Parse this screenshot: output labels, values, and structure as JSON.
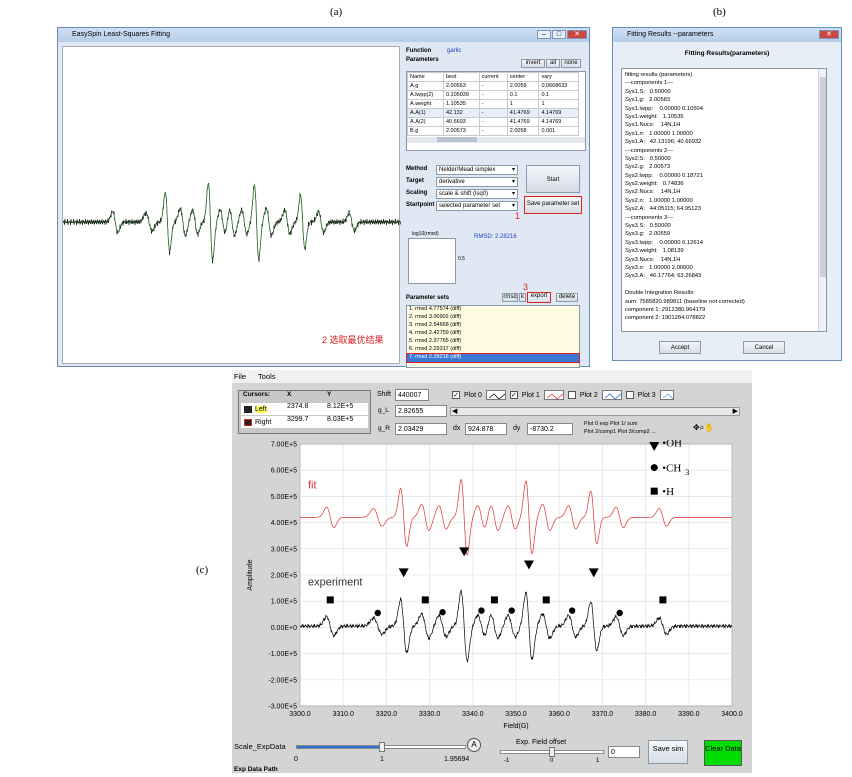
{
  "labels": {
    "a": "(a)",
    "b": "(b)",
    "c": "(c)"
  },
  "easyspin": {
    "title": "EasySpin Least-Squares Fitting",
    "function_label": "Function",
    "function_value": "garlic",
    "parameters_label": "Parameters",
    "buttons": {
      "invert": "invert",
      "all": "all",
      "none": "none",
      "start": "Start",
      "save_param": "Save parameter set",
      "rmsd": "rmsd",
      "k": "k",
      "export": "export",
      "delete": "delete"
    },
    "table_headers": [
      "Name",
      "best",
      "current",
      "center",
      "vary"
    ],
    "table_rows": [
      [
        "A.g",
        "2.00563",
        "-",
        "2.0059",
        "0.0668633"
      ],
      [
        "A.lwpp(2)",
        "0.105039",
        "-",
        "0.1",
        "0.1"
      ],
      [
        "A.weight",
        "1.10535",
        "-",
        "1",
        "1"
      ],
      [
        "A.A(1)",
        "42.132",
        "-",
        "41.4769",
        "4.14769"
      ],
      [
        "A.A(2)",
        "40.6693",
        "-",
        "41.4769",
        "4.14769"
      ],
      [
        "B.g",
        "2.00573",
        "-",
        "2.0058",
        "0.001"
      ]
    ],
    "method_label": "Method",
    "method_value": "Nelder/Mead simplex",
    "target_label": "Target",
    "target_value": "derivative",
    "scaling_label": "Scaling",
    "scaling_value": "scale & shift (lsq0)",
    "startpoint_label": "Startpoint",
    "startpoint_value": "selected parameter set",
    "log_label": "log10(rmsd)",
    "log_tick": "0.5",
    "rmsd_text": "RMSD: 2.28216",
    "param_sets_label": "Parameter sets",
    "param_sets": [
      "1. rmsd 4.77574 (diff)",
      "2. rmsd 3.00902 (diff)",
      "3. rmsd 2.54668 (diff)",
      "4. rmsd 2.42759 (diff)",
      "5. rmsd 2.37765 (diff)",
      "6. rmsd 2.29317 (diff)",
      "7. rmsd 2.28216 (diff)"
    ],
    "annot1": "1",
    "annot2": "2 选取最优结果",
    "annot3": "3"
  },
  "fitres": {
    "title": "Fitting Results --parameters",
    "heading": "Fitting Results(parameters)",
    "lines": [
      "fitting results (parameters)",
      "---components 1---",
      "Sys1.S:   0.50000",
      "Sys1.g:   2.00583",
      "Sys1.lwpp:    0.00000 0.10504",
      "Sys1.weight:   1.10535",
      "Sys1.Nucs:    14N,1H",
      "Sys1.n:   1.00000 1.00000",
      "Sys1.A:   42.13196; 40.66932",
      "---components 2---",
      "Sys2.S:   0.50000",
      "Sys2.g:   2.00573",
      "Sys2.lwpp:    0.00000 0.18721",
      "Sys2.weight:   0.74836",
      "Sys2.Nucs:    14N,1H",
      "Sys2.n:   1.00000 1.00000",
      "Sys2.A:   44.05115; 64.95123",
      "---components 3---",
      "Sys3.S:   0.50000",
      "Sys3.g:   2.00559",
      "Sys3.lwpp:    0.00000 0.12614",
      "Sys3.weight:   1.08139",
      "Sys3.Nucs:    14N,1H",
      "Sys3.n:   1.00000 2.00000",
      "Sys3.A:   46.17764; 63.26843",
      "",
      "Double Integration Results:",
      "sum: 7585820.989811 (baseline not corrected)",
      "component 1: 2912380.964179",
      "component 2: 1901284.078822"
    ],
    "accept": "Accept",
    "cancel": "Cancel"
  },
  "labview": {
    "menu": [
      "File",
      "Tools"
    ],
    "cursors_label": "Cursors:",
    "cursor_x": "X",
    "cursor_y": "Y",
    "cursor_rows": [
      [
        "Left",
        "2374.8",
        "8.12E+5"
      ],
      [
        "Right",
        "3299.7",
        "8.03E+5"
      ]
    ],
    "shift_label": "Shift",
    "shift_value": "440007",
    "gl_label": "g_L",
    "gl_value": "2.82655",
    "gr_label": "g_R",
    "gr_value": "2.03429",
    "dx_label": "dx",
    "dx_value": "924.878",
    "dy_label": "dy",
    "dy_value": "-8730.2",
    "plots": [
      "Plot 0",
      "Plot 1",
      "Plot 2",
      "Plot 3"
    ],
    "plot_legend_1": "Plot 0 exp  Plot 1/ sum",
    "plot_legend_2": "Plot 2/comp1  Plot 3/comp2 ...",
    "fit_label": "fit",
    "exp_label": "experiment",
    "legend_oh": "•OH",
    "legend_ch3": "•CH",
    "legend_ch3_sub": "3",
    "legend_h": "•H",
    "scale_label": "Scale_ExpData",
    "scale_ticks": [
      "0",
      "1",
      "1.95694"
    ],
    "exp_offset_label": "Exp. Field offset",
    "offset_ticks": [
      "-1",
      "0",
      "1"
    ],
    "offset_value": "0",
    "save_sim": "Save sim",
    "clear_data": "Clear Data",
    "exp_path": "Exp Data Path"
  },
  "chart_data": {
    "type": "line",
    "xlabel": "Field(G)",
    "ylabel": "Amplitude",
    "xlim": [
      3300,
      3400
    ],
    "ylim": [
      -300000,
      700000
    ],
    "x_ticks": [
      "3300.0",
      "3310.0",
      "3320.0",
      "3330.0",
      "3340.0",
      "3350.0",
      "3360.0",
      "3370.0",
      "3380.0",
      "3390.0",
      "3400.0"
    ],
    "y_ticks": [
      "7.00E+5",
      "6.00E+5",
      "5.00E+5",
      "4.00E+5",
      "3.00E+5",
      "2.00E+5",
      "1.00E+5",
      "0.00E+0",
      "-1.00E+5",
      "-2.00E+5",
      "-3.00E+5"
    ],
    "series": [
      {
        "name": "fit",
        "color": "#e03030",
        "offset": 420000
      },
      {
        "name": "experiment",
        "color": "#000000",
        "offset": 5000
      }
    ],
    "markers": {
      "triangle": [
        3324,
        3338,
        3353,
        3368
      ],
      "circle": [
        3318,
        3333,
        3342,
        3349,
        3363,
        3374
      ],
      "square": [
        3307,
        3329,
        3345,
        3357,
        3384
      ]
    }
  }
}
